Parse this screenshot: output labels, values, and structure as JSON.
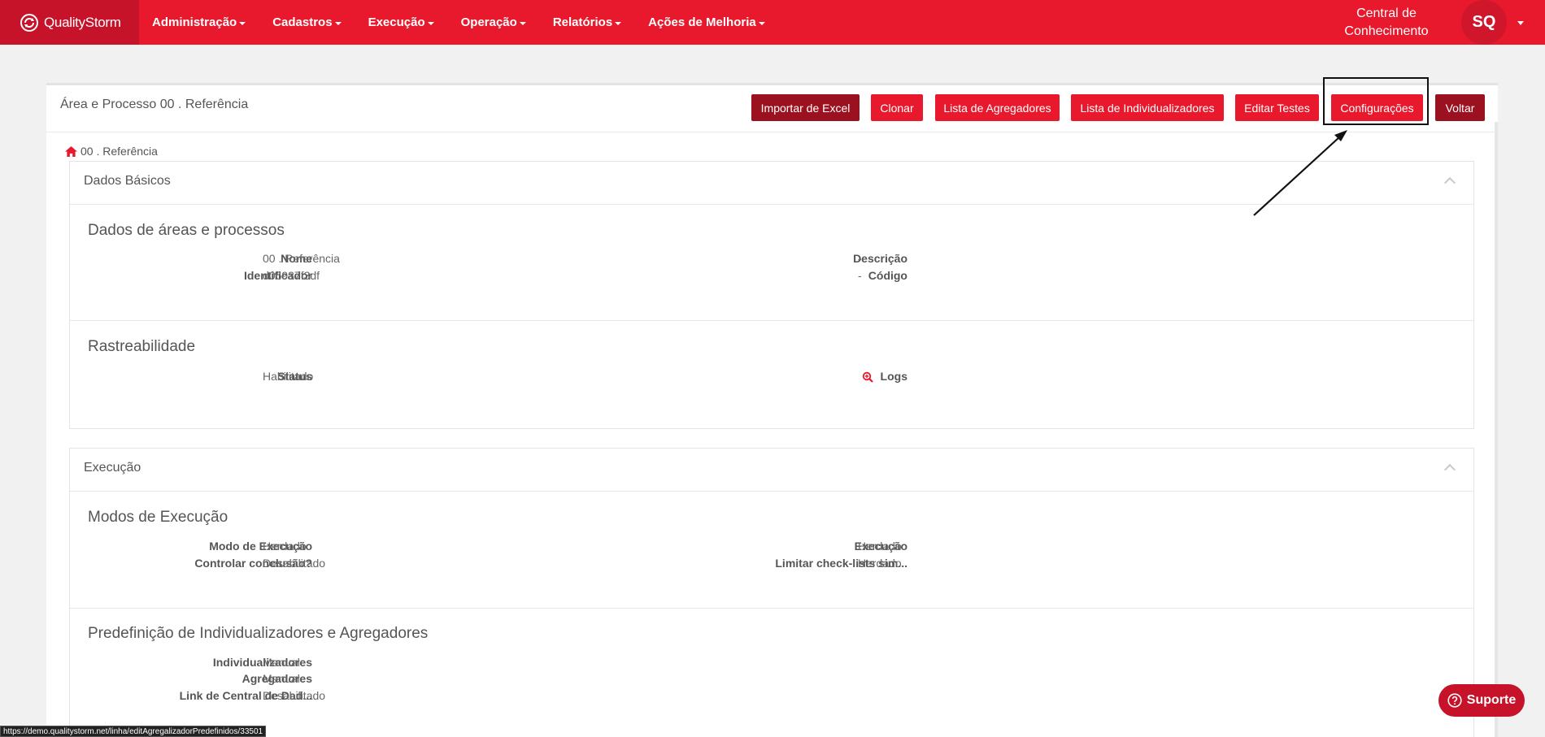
{
  "brand": {
    "name": "QualityStorm"
  },
  "nav": {
    "items": [
      {
        "label": "Administração"
      },
      {
        "label": "Cadastros"
      },
      {
        "label": "Execução"
      },
      {
        "label": "Operação"
      },
      {
        "label": "Relatórios"
      },
      {
        "label": "Ações de Melhoria"
      }
    ],
    "knowledge_line1": "Central de",
    "knowledge_line2": "Conhecimento",
    "user_initials": "SQ"
  },
  "page": {
    "title": "Área e Processo 00 . Referência",
    "buttons": {
      "import_excel": "Importar de Excel",
      "clone": "Clonar",
      "aggregators": "Lista de Agregadores",
      "individualizers": "Lista de Individualizadores",
      "edit_tests": "Editar Testes",
      "settings": "Configurações",
      "back": "Voltar"
    },
    "breadcrumb": "00 . Referência"
  },
  "basic_data": {
    "header": "Dados Básicos",
    "areas": {
      "title": "Dados de áreas e processos",
      "name_label": "Nome",
      "name_value": "00 . Referência",
      "id_label": "Identificador",
      "id_value": "d06937f3df",
      "desc_label": "Descrição",
      "desc_value": "-",
      "code_label": "Código",
      "code_value": "-"
    },
    "trace": {
      "title": "Rastreabilidade",
      "status_label": "Status",
      "status_value": "Habilitado",
      "logs_label": "Logs"
    }
  },
  "execution": {
    "header": "Execução",
    "modes": {
      "title": "Modos de Execução",
      "mode_label": "Modo de Execução",
      "mode_value": "Herdado",
      "control_label": "Controlar conclusão?",
      "control_value": "Desabilitado",
      "exec_label": "Execução",
      "exec_value": "Herdado",
      "limit_label": "Limitar check-lists sim...",
      "limit_value": "Herdado"
    },
    "predef": {
      "title": "Predefinição de Individualizadores e Agregadores",
      "ind_label": "Individualizadores",
      "ind_value": "Manual",
      "agg_label": "Agregadores",
      "agg_value": "Manual",
      "link_label": "Link de Central de Dad...",
      "link_value": "Desabilitado"
    }
  },
  "support": {
    "label": "Suporte"
  },
  "status_bar": {
    "url": "https://demo.qualitystorm.net/linha/editAgregalizadorPredefinidos/33501"
  },
  "colors": {
    "primary": "#e8192c",
    "dark": "#9b1120",
    "brand_bg": "#c6132a"
  }
}
